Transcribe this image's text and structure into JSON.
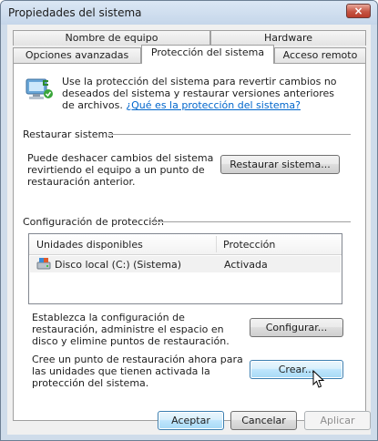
{
  "window": {
    "title": "Propiedades del sistema",
    "close_symbol": "×"
  },
  "tabs": {
    "row1": [
      {
        "label": "Nombre de equipo"
      },
      {
        "label": "Hardware"
      }
    ],
    "row2": [
      {
        "label": "Opciones avanzadas"
      },
      {
        "label": "Protección del sistema",
        "active": true
      },
      {
        "label": "Acceso remoto"
      }
    ]
  },
  "intro": {
    "text": "Use la protección del sistema para revertir cambios no deseados del sistema y restaurar versiones anteriores de archivos.",
    "link": "¿Qué es la protección del sistema?"
  },
  "restore": {
    "heading": "Restaurar sistema",
    "description": "Puede deshacer cambios del sistema revirtiendo el equipo a un punto de restauración anterior.",
    "button": "Restaurar sistema..."
  },
  "protection": {
    "heading": "Configuración de protección",
    "columns": [
      "Unidades disponibles",
      "Protección"
    ],
    "rows": [
      {
        "drive": "Disco local (C:) (Sistema)",
        "status": "Activada"
      }
    ],
    "configure_text": "Establezca la configuración de restauración, administre el espacio en disco y elimine puntos de restauración.",
    "configure_button": "Configurar...",
    "create_text": "Cree un punto de restauración ahora para las unidades que tienen activada la protección del sistema.",
    "create_button": "Crear..."
  },
  "footer": {
    "ok": "Aceptar",
    "cancel": "Cancelar",
    "apply": "Aplicar"
  }
}
